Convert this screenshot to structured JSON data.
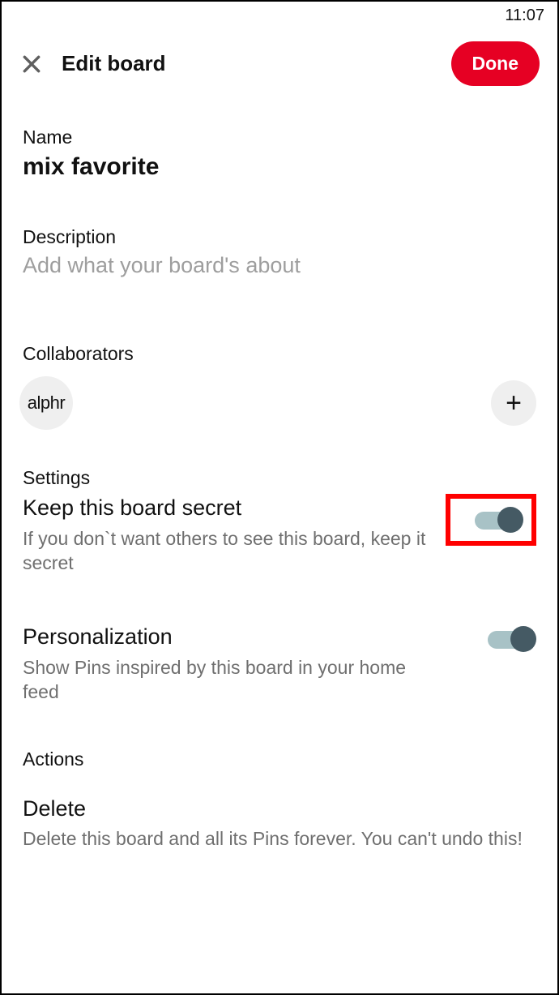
{
  "status_bar": {
    "time": "11:07"
  },
  "header": {
    "title": "Edit board",
    "done_label": "Done"
  },
  "name_section": {
    "label": "Name",
    "value": "mix favorite"
  },
  "description_section": {
    "label": "Description",
    "placeholder": "Add what your board's about"
  },
  "collaborators_section": {
    "label": "Collaborators",
    "avatar_text": "alphr"
  },
  "settings_section": {
    "label": "Settings",
    "secret": {
      "title": "Keep this board secret",
      "desc": "If you don`t want others to see this board, keep it secret",
      "toggle_on": true,
      "highlighted": true
    },
    "personalization": {
      "title": "Personalization",
      "desc": "Show Pins inspired by this board in your home feed",
      "toggle_on": true
    }
  },
  "actions_section": {
    "label": "Actions",
    "delete": {
      "title": "Delete",
      "desc": "Delete this board and all its Pins forever. You can't undo this!"
    }
  }
}
